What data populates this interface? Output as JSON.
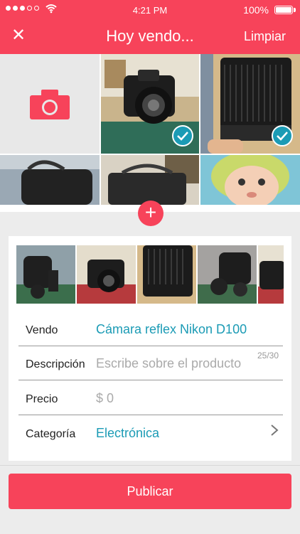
{
  "status": {
    "time": "4:21 PM",
    "battery": "100%"
  },
  "nav": {
    "title": "Hoy vendo...",
    "clear_label": "Limpiar",
    "close_icon": "close-icon"
  },
  "grid": {
    "photos": [
      {
        "label": "Nikon camera photo",
        "selected": true
      },
      {
        "label": "Nikon lens photo",
        "selected": true
      },
      {
        "label": "bag photo 1",
        "selected": false
      },
      {
        "label": "bag photo 2",
        "selected": false
      },
      {
        "label": "baby photo",
        "selected": false
      }
    ]
  },
  "form": {
    "vendo": {
      "label": "Vendo",
      "value": "Cámara reflex Nikon D100",
      "count": "25/30"
    },
    "descripcion": {
      "label": "Descripción",
      "placeholder": "Escribe sobre el producto"
    },
    "precio": {
      "label": "Precio",
      "placeholder": "$ 0"
    },
    "categoria": {
      "label": "Categoría",
      "value": "Electrónica"
    }
  },
  "publish_label": "Publicar",
  "colors": {
    "brand": "#f7435a",
    "accent": "#1b9bb5"
  }
}
